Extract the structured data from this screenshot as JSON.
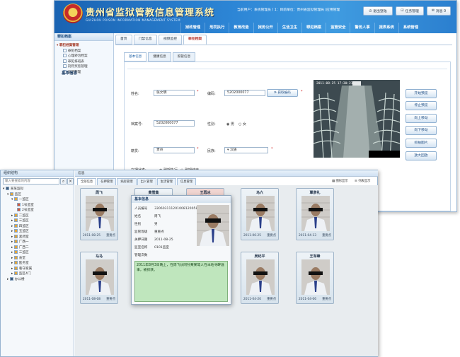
{
  "app": {
    "title": "贵州省监狱管教信息管理系统",
    "subtitle": "GUIZHOU PRISON INFORMATION MANAGEMENT SYSTEM",
    "user_info": "当前用户：系统管理员 / 1：目前单位：贵州省监狱管理局 /应用管理",
    "btn_logout": "退出登陆",
    "btn_tasks": "任务管理",
    "btn_messages": "消息 0"
  },
  "nav": [
    "狱政管理",
    "刑罚执行",
    "教育改造",
    "狱务公开",
    "生活卫生",
    "罪犯档案",
    "监管安全",
    "警务人事",
    "报表系统",
    "系统管理"
  ],
  "sidebar": {
    "title": "罪犯档案",
    "group": "罪犯档案管理",
    "items": [
      "罪犯档案",
      "心理矫治档案",
      "罪犯排班表",
      "刑罚奖惩管理",
      "监区管理"
    ]
  },
  "tabs": [
    "首页",
    "门禁信息",
    "视频监控",
    "罪犯档案"
  ],
  "subtabs": [
    "基本信息",
    "健康信息",
    "照管信息"
  ],
  "form": {
    "section": "基本信息",
    "name_label": "姓名:",
    "name_value": "张文明",
    "code_label": "编码:",
    "code_value": "5202000077",
    "fetch_btn": "获取编码",
    "file_label": "档案号:",
    "file_value": "5202000077",
    "gender_label": "性别:",
    "gender_options": [
      "男",
      "女"
    ],
    "origin_label": "籍贯:",
    "origin_value": "贵州",
    "ethnic_label": "民族:",
    "ethnic_value": "汉族",
    "status_label": "在押状态:",
    "status_options": [
      "刑期执行",
      "刑期结束"
    ]
  },
  "video_buttons": [
    "开始预览",
    "停止预览",
    "向上移动",
    "向下移动",
    "抓拍图片",
    "放大回放"
  ],
  "cam": {
    "overlay": "2011-08-25 17:30:21"
  },
  "w2": {
    "left_title": "组织结构",
    "search_placeholder": "输入要搜索的内容",
    "root": "某某监狱",
    "tree": [
      "监区",
      "一监区",
      "1号监室",
      "2号监室",
      "二监区",
      "三监区",
      "四监区",
      "五监区",
      "紧闭室",
      "广西一",
      "广西二",
      "三监区",
      "食堂",
      "医务室",
      "看守家属",
      "监区4门",
      "办公楼"
    ],
    "main_title": "信息",
    "tabs": [
      "全部信息",
      "在押管理",
      "病房管理",
      "出入管理",
      "生活管理",
      "信息管理"
    ],
    "view_icons": "图形显示",
    "view_list": "列表显示"
  },
  "cards": [
    {
      "name": "周飞",
      "date": "2011-08-25",
      "level": "重要点"
    },
    {
      "name": "黄雪集",
      "date": "",
      "level": ""
    },
    {
      "name": "王再冰",
      "date": "",
      "level": ""
    },
    {
      "name": "马六",
      "date": "2011-06-25",
      "level": "重要点"
    },
    {
      "name": "覃彦礼",
      "date": "2011-04-13",
      "level": "重要点"
    },
    {
      "name": "马马",
      "date": "2011-08-08",
      "level": "重要点"
    },
    {
      "name": "吴纪平",
      "date": "2011-04-20",
      "level": "重要点"
    },
    {
      "name": "王军峰",
      "date": "2011-04-06",
      "level": "重要点"
    }
  ],
  "popup": {
    "title": "基本信息",
    "rows": [
      [
        "人员编号",
        "330603111201008120058"
      ],
      [
        "姓名",
        "周飞"
      ],
      [
        "性别",
        "男"
      ],
      [
        "监管等级",
        "重重点"
      ],
      [
        "关押日期",
        "2011-08-25"
      ],
      [
        "监室名称",
        "0101监室"
      ],
      [
        "管理次数",
        ""
      ]
    ],
    "note": "2011年8月3日晚上，在周飞伙同孙某某等人在本地寻衅滋事，被抓获。"
  }
}
